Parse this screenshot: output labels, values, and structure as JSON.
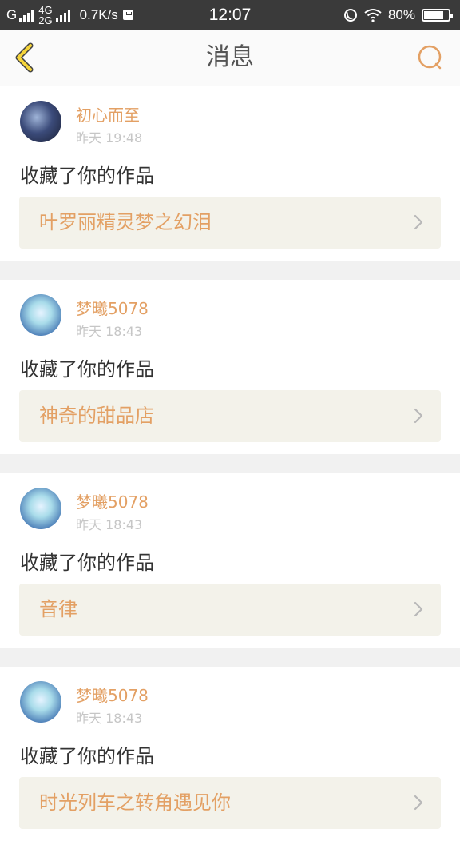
{
  "status_bar": {
    "network_g": "G",
    "net_4g": "4G",
    "net_2g": "2G",
    "speed": "0.7K/s",
    "time": "12:07",
    "battery": "80%",
    "battery_level": 0.8
  },
  "header": {
    "title": "消息",
    "back_icon": "chevron-left-icon",
    "search_icon": "search-icon"
  },
  "colors": {
    "accent": "#e3a064",
    "back_icon": "#f5d43a",
    "card_link_bg": "#f3f2ea"
  },
  "messages": [
    {
      "user": "初心而至",
      "time": "昨天 19:48",
      "action": "收藏了你的作品",
      "work": "叶罗丽精灵梦之幻泪"
    },
    {
      "user": "梦曦5078",
      "time": "昨天 18:43",
      "action": "收藏了你的作品",
      "work": "神奇的甜品店"
    },
    {
      "user": "梦曦5078",
      "time": "昨天 18:43",
      "action": "收藏了你的作品",
      "work": "音律"
    },
    {
      "user": "梦曦5078",
      "time": "昨天 18:43",
      "action": "收藏了你的作品",
      "work": "时光列车之转角遇见你"
    }
  ]
}
